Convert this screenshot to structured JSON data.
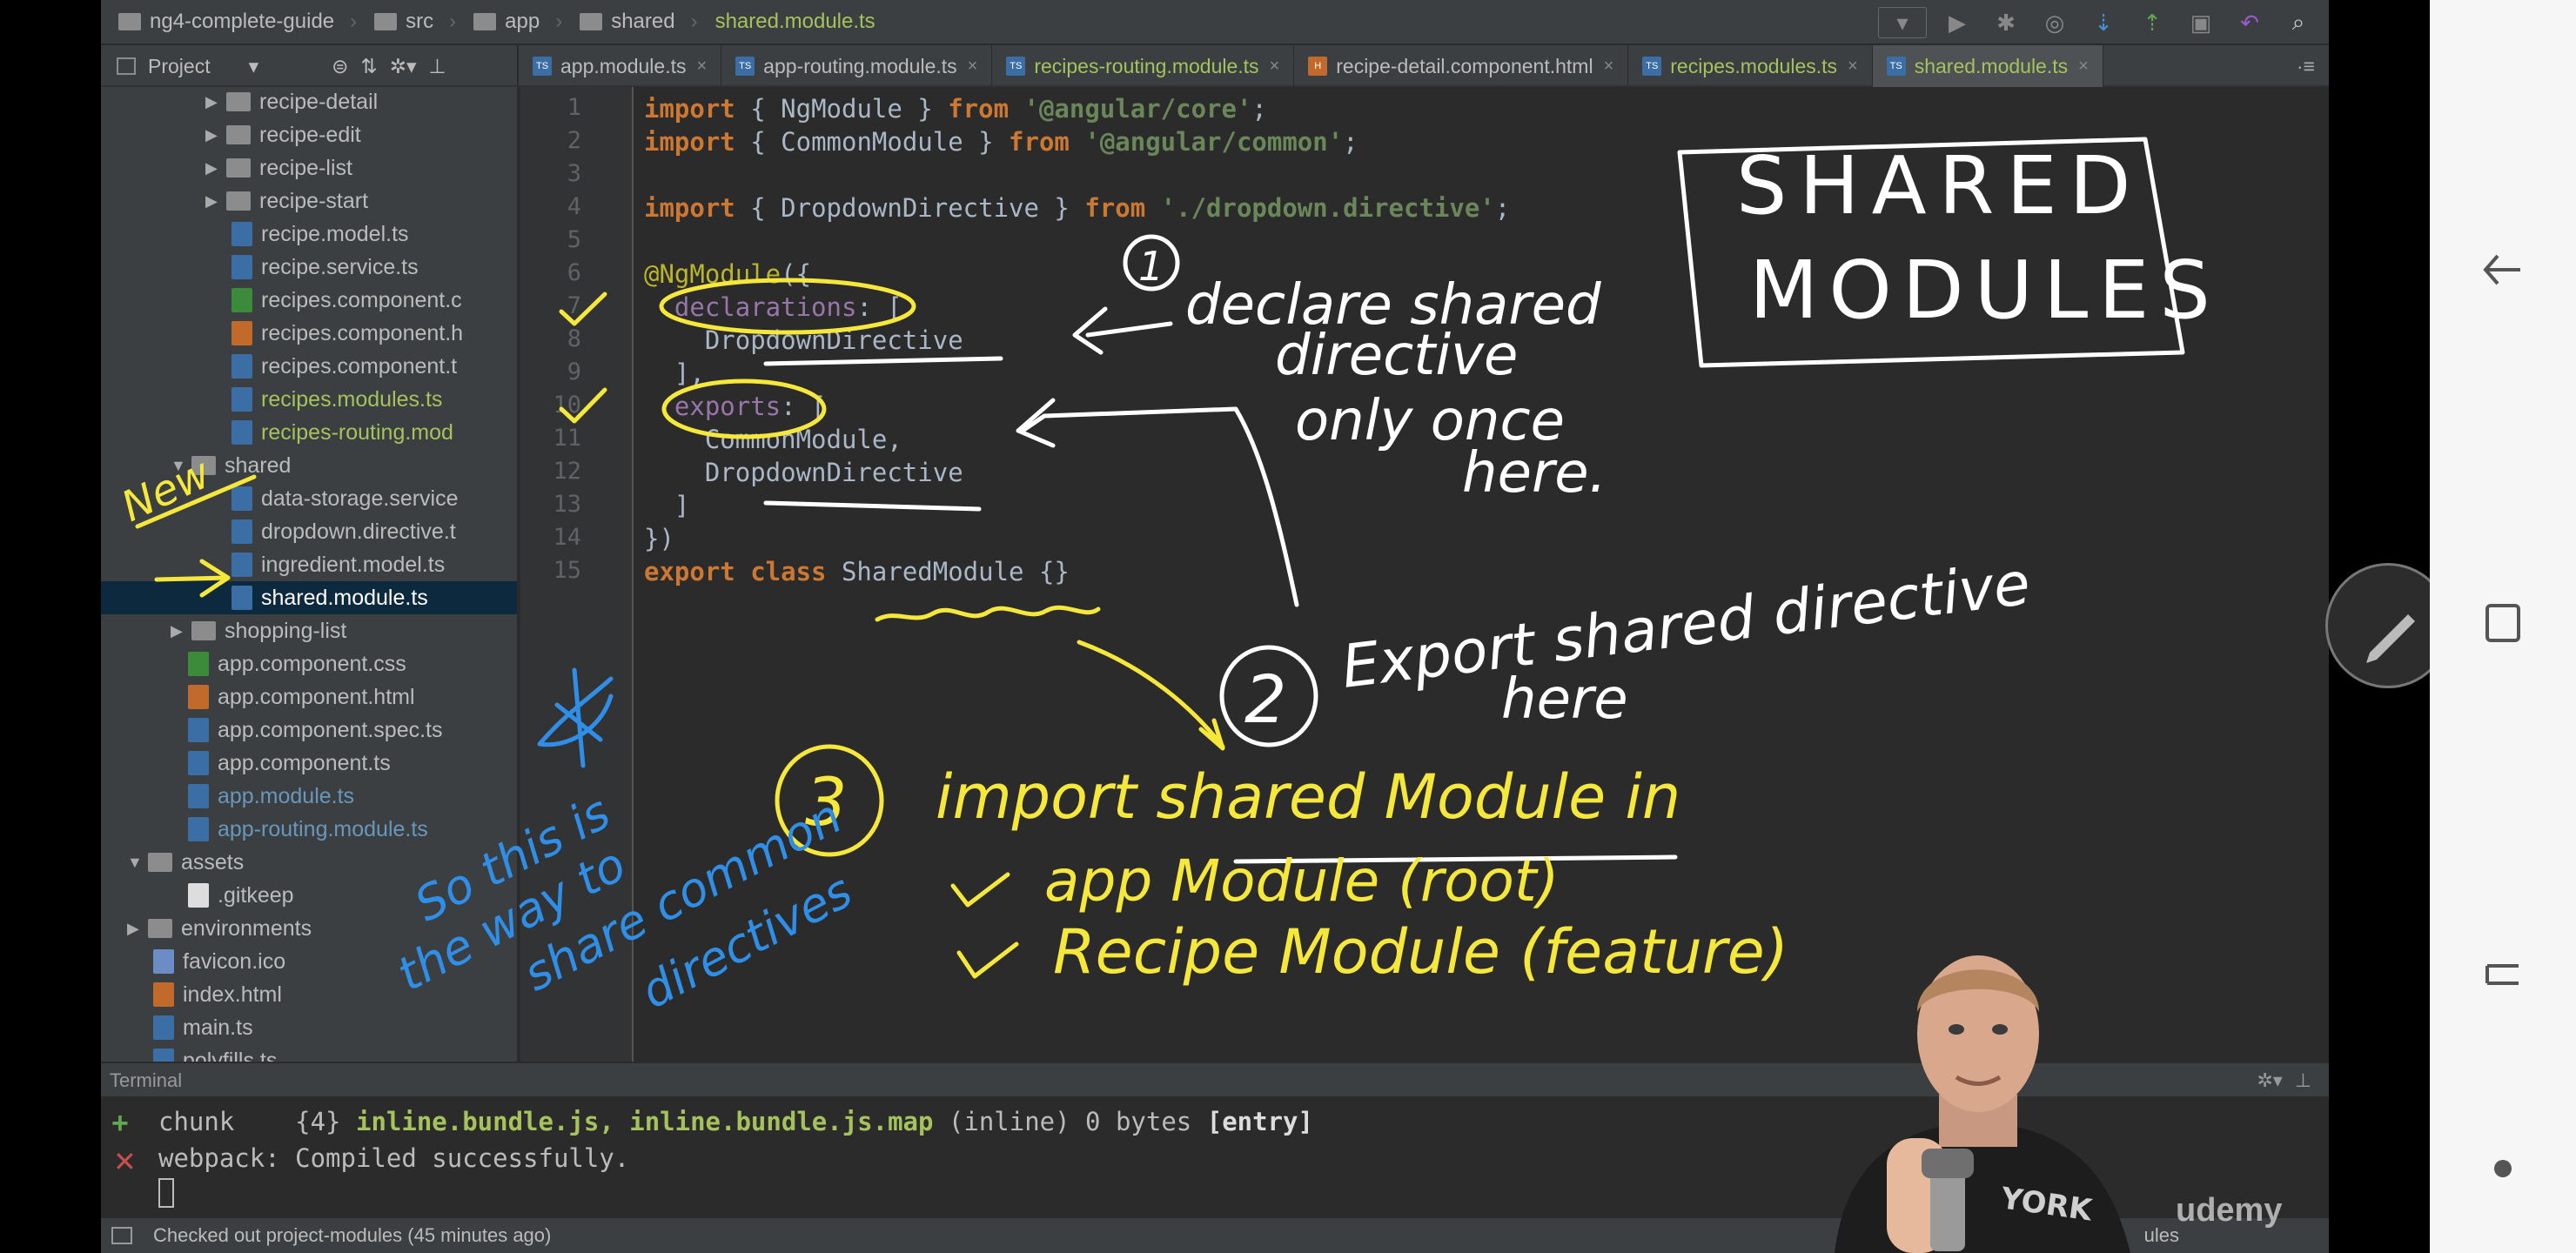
{
  "breadcrumb": {
    "items": [
      "ng4-complete-guide",
      "src",
      "app",
      "shared"
    ],
    "file": "shared.module.ts"
  },
  "project_panel": {
    "label": "Project"
  },
  "tabs": [
    {
      "label": "app.module.ts",
      "active": false,
      "color": "#bbbbbb"
    },
    {
      "label": "app-routing.module.ts",
      "active": false,
      "color": "#bbbbbb"
    },
    {
      "label": "recipes-routing.module.ts",
      "active": false,
      "color": "#a5c25c"
    },
    {
      "label": "recipe-detail.component.html",
      "active": false,
      "color": "#bbbbbb"
    },
    {
      "label": "recipes.modules.ts",
      "active": false,
      "color": "#a5c25c"
    },
    {
      "label": "shared.module.ts",
      "active": true,
      "color": "#a5c25c"
    }
  ],
  "tabs_menu": "·≡",
  "tree": [
    {
      "label": "recipe-detail",
      "type": "folder"
    },
    {
      "label": "recipe-edit",
      "type": "folder"
    },
    {
      "label": "recipe-list",
      "type": "folder"
    },
    {
      "label": "recipe-start",
      "type": "folder"
    },
    {
      "label": "recipe.model.ts",
      "type": "ts"
    },
    {
      "label": "recipe.service.ts",
      "type": "ts"
    },
    {
      "label": "recipes.component.c",
      "type": "css"
    },
    {
      "label": "recipes.component.h",
      "type": "html"
    },
    {
      "label": "recipes.component.t",
      "type": "ts"
    },
    {
      "label": "recipes.modules.ts",
      "type": "ts",
      "status": "added"
    },
    {
      "label": "recipes-routing.mod",
      "type": "ts",
      "status": "added"
    },
    {
      "label": "shared",
      "type": "folder-open"
    },
    {
      "label": "data-storage.service",
      "type": "ts"
    },
    {
      "label": "dropdown.directive.t",
      "type": "ts"
    },
    {
      "label": "ingredient.model.ts",
      "type": "ts"
    },
    {
      "label": "shared.module.ts",
      "type": "ts",
      "selected": true
    },
    {
      "label": "shopping-list",
      "type": "folder"
    },
    {
      "label": "app.component.css",
      "type": "css"
    },
    {
      "label": "app.component.html",
      "type": "html"
    },
    {
      "label": "app.component.spec.ts",
      "type": "ts"
    },
    {
      "label": "app.component.ts",
      "type": "ts"
    },
    {
      "label": "app.module.ts",
      "type": "ts",
      "status": "modified"
    },
    {
      "label": "app-routing.module.ts",
      "type": "ts",
      "status": "modified"
    },
    {
      "label": "assets",
      "type": "folder-open"
    },
    {
      "label": ".gitkeep",
      "type": "txt"
    },
    {
      "label": "environments",
      "type": "folder"
    },
    {
      "label": "favicon.ico",
      "type": "ico"
    },
    {
      "label": "index.html",
      "type": "html"
    },
    {
      "label": "main.ts",
      "type": "ts"
    },
    {
      "label": "polyfills.ts",
      "type": "ts"
    }
  ],
  "code": {
    "line_numbers": [
      "1",
      "2",
      "3",
      "4",
      "5",
      "6",
      "7",
      "8",
      "9",
      "10",
      "11",
      "12",
      "13",
      "14",
      "15"
    ],
    "lines": [
      [
        [
          "kw",
          "import"
        ],
        [
          "p",
          " { NgModule } "
        ],
        [
          "kw",
          "from"
        ],
        [
          "p",
          " "
        ],
        [
          "str",
          "'@angular/core'"
        ],
        [
          "p",
          ";"
        ]
      ],
      [
        [
          "kw",
          "import"
        ],
        [
          "p",
          " { CommonModule } "
        ],
        [
          "kw",
          "from"
        ],
        [
          "p",
          " "
        ],
        [
          "str",
          "'@angular/common'"
        ],
        [
          "p",
          ";"
        ]
      ],
      [],
      [
        [
          "kw",
          "import"
        ],
        [
          "p",
          " { DropdownDirective } "
        ],
        [
          "kw",
          "from"
        ],
        [
          "p",
          " "
        ],
        [
          "str",
          "'./dropdown.directive'"
        ],
        [
          "p",
          ";"
        ]
      ],
      [],
      [
        [
          "dec",
          "@NgModule"
        ],
        [
          "p",
          "({"
        ]
      ],
      [
        [
          "p",
          "  "
        ],
        [
          "prop",
          "declarations"
        ],
        [
          "p",
          ": ["
        ]
      ],
      [
        [
          "p",
          "    DropdownDirective"
        ]
      ],
      [
        [
          "p",
          "  ],"
        ]
      ],
      [
        [
          "p",
          "  "
        ],
        [
          "prop",
          "exports"
        ],
        [
          "p",
          ": ["
        ]
      ],
      [
        [
          "p",
          "    CommonModule,"
        ]
      ],
      [
        [
          "p",
          "    DropdownDirective"
        ]
      ],
      [
        [
          "p",
          "  ]"
        ]
      ],
      [
        [
          "p",
          "})"
        ]
      ],
      [
        [
          "kw",
          "export class"
        ],
        [
          "p",
          " SharedModule {}"
        ]
      ]
    ]
  },
  "terminal": {
    "title": "Terminal",
    "line1_prefix": "chunk    {4} ",
    "line1_files": "inline.bundle.js, inline.bundle.js.map",
    "line1_suffix": " (inline) 0 bytes ",
    "line1_tag": "[entry]",
    "line2": "webpack: Compiled successfully."
  },
  "status": {
    "message": "Checked out project-modules (45 minutes ago)",
    "right_partial": "ules"
  },
  "annotations": {
    "title_line1": "SHARED",
    "title_line2": "MODULES",
    "step1_num": "1",
    "step1_l1": "declare shared",
    "step1_l2": "directive",
    "step1_l3": "only once",
    "step1_l4": "here.",
    "step2_num": "2",
    "step2_l1": "Export shared directive",
    "step2_l2": "here",
    "step3_num": "3",
    "step3_l1": "import shared Module  in",
    "step3_l2": "app Module (root)",
    "step3_l3": "Recipe Module (feature)",
    "new_label": "New",
    "side_l1": "So this is",
    "side_l2": "the way to",
    "side_l3": "share common",
    "side_l4": "directives"
  },
  "watermark": "udemy",
  "colors": {
    "ink_white": "#ffffff",
    "ink_yellow": "#f6e73b",
    "ink_blue": "#2f8fe8",
    "vcs_added": "#a5c25c",
    "vcs_modified": "#6897bb"
  }
}
